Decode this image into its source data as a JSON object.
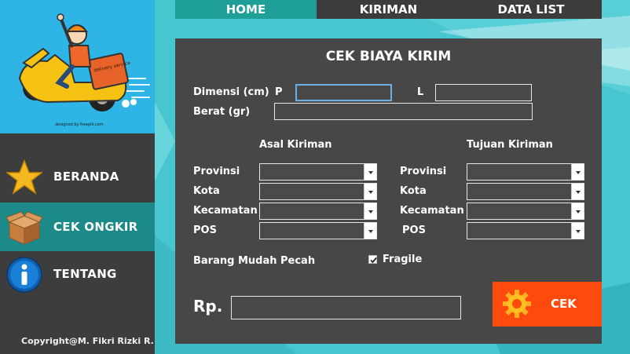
{
  "sidebar": {
    "hero": {
      "badge_text": "delivery service",
      "credit": "designed by freepik.com"
    },
    "items": [
      {
        "label": "BERANDA",
        "icon": "star-icon"
      },
      {
        "label": "CEK ONGKIR",
        "icon": "box-icon"
      },
      {
        "label": "TENTANG",
        "icon": "info-icon"
      }
    ],
    "copyright": "Copyright@M. Fikri Rizki R."
  },
  "tabs": [
    {
      "label": "HOME"
    },
    {
      "label": "KIRIMAN"
    },
    {
      "label": "DATA LIST"
    }
  ],
  "form": {
    "title": "CEK BIAYA KIRIM",
    "dimensi_label": "Dimensi (cm)",
    "p_label": "P",
    "l_label": "L",
    "berat_label": "Berat (gr)",
    "asal_header": "Asal Kiriman",
    "tujuan_header": "Tujuan Kiriman",
    "asal": {
      "provinsi": "Provinsi",
      "kota": "Kota",
      "kecamatan": "Kecamatan",
      "pos": "POS"
    },
    "tujuan": {
      "provinsi": "Provinsi",
      "kota": "Kota",
      "kecamatan": "Kecamatan",
      "pos": "POS"
    },
    "fragile_label": "Barang Mudah Pecah",
    "fragile_checkbox_label": "Fragile",
    "fragile_checked": true,
    "rp_label": "Rp.",
    "cek_button_label": "CEK"
  },
  "colors": {
    "sidebar_bg": "#3d3d3d",
    "sidebar_active": "#1d8a8a",
    "hero_bg": "#2fb4e6",
    "main_bg": "#48c6cf",
    "tab_active": "#1e9f98",
    "card_bg": "#474747",
    "cek_button": "#fd4a0d"
  }
}
